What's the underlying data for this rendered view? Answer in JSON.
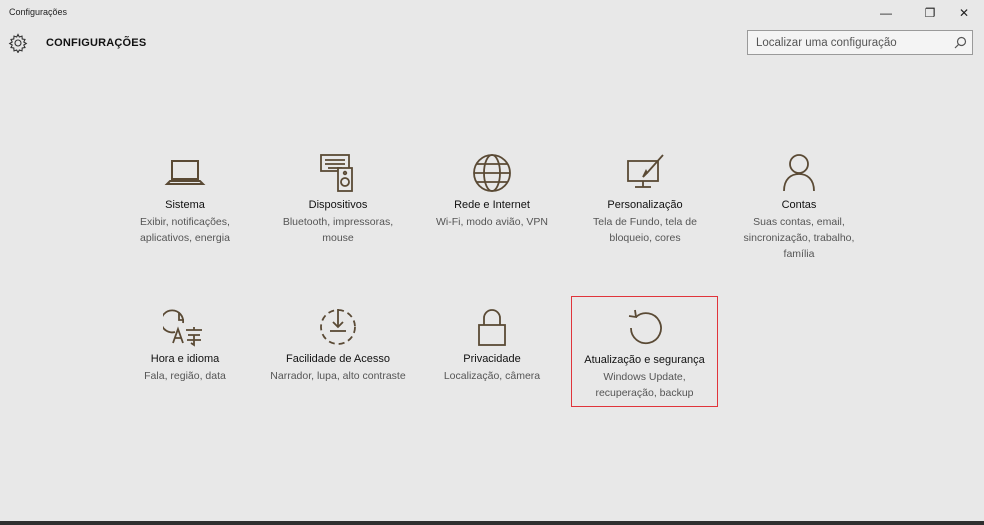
{
  "window": {
    "title": "Configurações",
    "minimize_glyph": "—",
    "maximize_glyph": "❐",
    "close_glyph": "✕"
  },
  "header": {
    "title": "CONFIGURAÇÕES",
    "search_placeholder": "Localizar uma configuração"
  },
  "colors": {
    "icon": "#5a4a35",
    "highlight_border": "#e0343b",
    "background": "#e8e8e8"
  },
  "tiles": [
    {
      "icon": "laptop-icon",
      "title": "Sistema",
      "desc": "Exibir, notificações, aplicativos, energia"
    },
    {
      "icon": "devices-icon",
      "title": "Dispositivos",
      "desc": "Bluetooth, impressoras, mouse"
    },
    {
      "icon": "globe-icon",
      "title": "Rede e Internet",
      "desc": "Wi-Fi, modo avião, VPN"
    },
    {
      "icon": "personalization-icon",
      "title": "Personalização",
      "desc": "Tela de Fundo, tela de bloqueio, cores"
    },
    {
      "icon": "person-icon",
      "title": "Contas",
      "desc": "Suas contas, email, sincronização, trabalho, família"
    },
    {
      "icon": "time-language-icon",
      "title": "Hora e idioma",
      "desc": "Fala, região, data"
    },
    {
      "icon": "ease-of-access-icon",
      "title": "Facilidade de Acesso",
      "desc": "Narrador, lupa, alto contraste"
    },
    {
      "icon": "lock-icon",
      "title": "Privacidade",
      "desc": "Localização, câmera"
    },
    {
      "icon": "update-icon",
      "title": "Atualização e segurança",
      "desc": "Windows Update, recuperação, backup",
      "selected": true
    }
  ]
}
